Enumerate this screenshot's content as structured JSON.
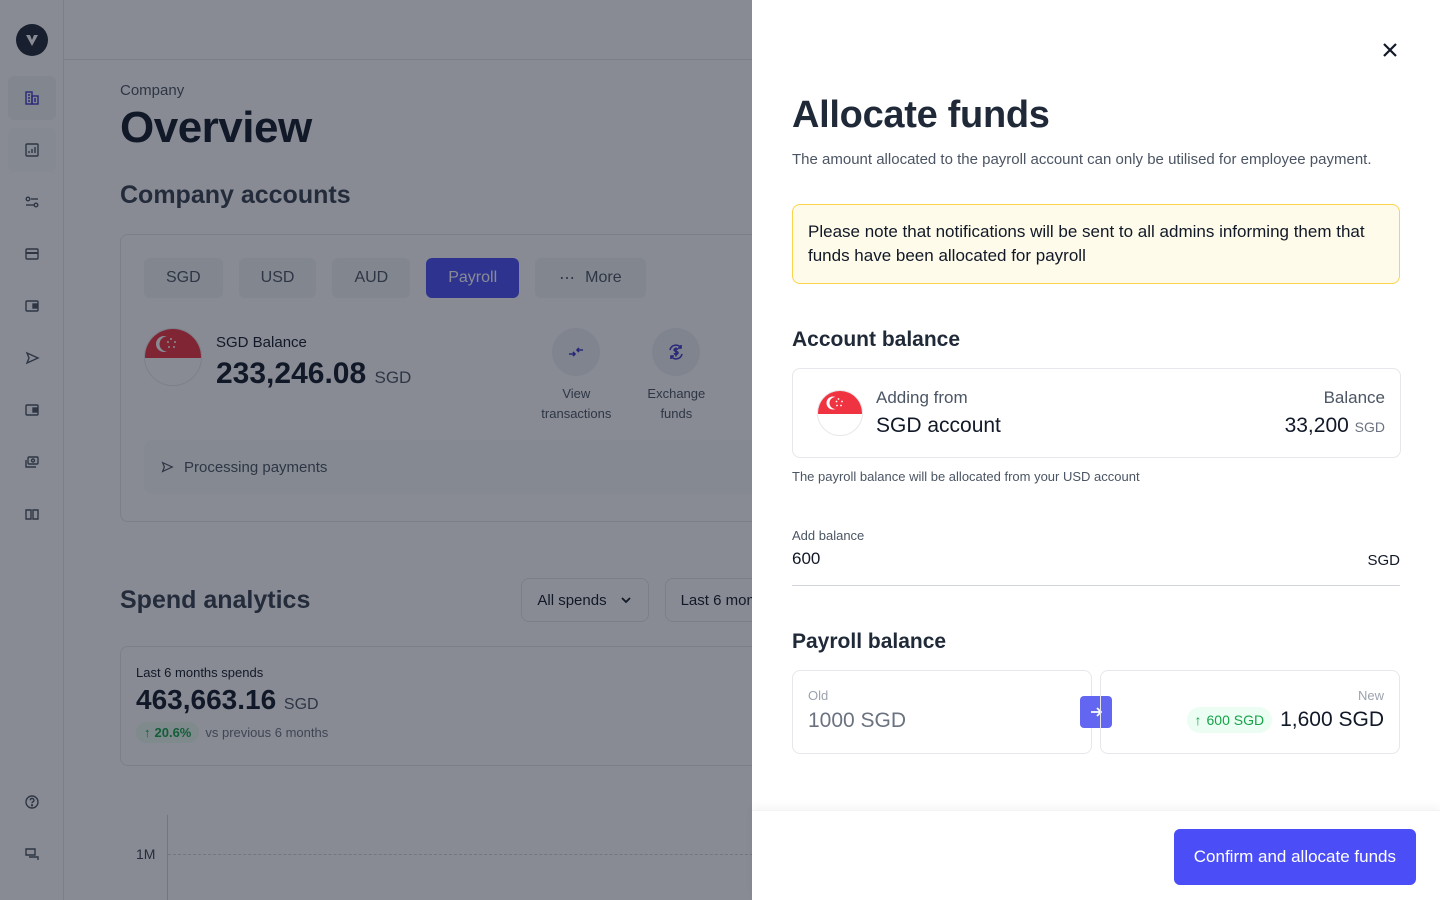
{
  "sidebar": {
    "logo": "v-logo",
    "items": [
      {
        "icon": "building-icon",
        "name": "company",
        "active": true
      },
      {
        "icon": "chart-icon",
        "name": "analytics"
      },
      {
        "icon": "sliders-icon",
        "name": "controls"
      },
      {
        "icon": "card-icon",
        "name": "cards"
      },
      {
        "icon": "wallet-icon",
        "name": "wallet"
      },
      {
        "icon": "send-icon",
        "name": "payments"
      },
      {
        "icon": "wallet-icon",
        "name": "accounts"
      },
      {
        "icon": "cash-icon",
        "name": "payroll"
      },
      {
        "icon": "book-icon",
        "name": "guides"
      }
    ],
    "bottom": [
      {
        "icon": "help-icon",
        "name": "help"
      },
      {
        "icon": "chat-icon",
        "name": "messages"
      }
    ]
  },
  "page": {
    "breadcrumb": "Company",
    "title": "Overview",
    "accounts_title": "Company accounts",
    "tabs": [
      {
        "label": "SGD"
      },
      {
        "label": "USD"
      },
      {
        "label": "AUD"
      },
      {
        "label": "Payroll",
        "active": true
      },
      {
        "label": "More"
      }
    ],
    "balance": {
      "label": "SGD Balance",
      "value": "233,246.08",
      "currency": "SGD"
    },
    "actions": [
      {
        "label": "View transactions",
        "icon": "arrows-in-icon"
      },
      {
        "label": "Exchange funds",
        "icon": "exchange-icon"
      }
    ],
    "processing": "Processing payments",
    "spend": {
      "title": "Spend analytics",
      "filter_type": "All spends",
      "filter_period": "Last 6 mon",
      "label": "Last 6 months spends",
      "value": "463,663.16",
      "currency": "SGD",
      "delta": "20.6%",
      "delta_text": "vs previous 6 months",
      "chart_tick": "1M"
    }
  },
  "drawer": {
    "title": "Allocate funds",
    "subtitle": "The amount allocated to the payroll account can only be utilised for employee payment.",
    "notice": "Please note that notifications will be sent to all admins informing them that funds have been allocated for payroll",
    "account_section": "Account balance",
    "account": {
      "label": "Adding from",
      "name": "SGD account",
      "balance_label": "Balance",
      "balance": "33,200",
      "currency": "SGD"
    },
    "hint": "The payroll balance will be allocated from your USD account",
    "add_balance": {
      "label": "Add balance",
      "value": "600",
      "suffix": "SGD"
    },
    "payroll_section": "Payroll balance",
    "old": {
      "label": "Old",
      "value": "1000 SGD"
    },
    "new": {
      "label": "New",
      "delta": "600 SGD",
      "value": "1,600 SGD"
    },
    "confirm_label": "Confirm and allocate funds"
  },
  "colors": {
    "accent": "#4b4ef7",
    "success": "#16a34a",
    "notice_bg": "#fefbea",
    "notice_border": "#fcd34d"
  }
}
